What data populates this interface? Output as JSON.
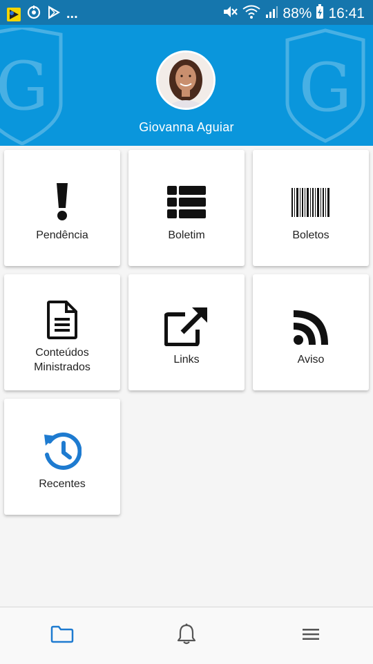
{
  "status_bar": {
    "overflow": "...",
    "battery": "88%",
    "time": "16:41"
  },
  "profile": {
    "name": "Giovanna Aguiar"
  },
  "watermark_letter": "G",
  "tiles": [
    {
      "label": "Pendência",
      "icon": "exclamation-icon"
    },
    {
      "label": "Boletim",
      "icon": "table-icon"
    },
    {
      "label": "Boletos",
      "icon": "barcode-icon"
    },
    {
      "label_line1": "Conteúdos",
      "label_line2": "Ministrados",
      "icon": "document-icon"
    },
    {
      "label": "Links",
      "icon": "external-link-icon"
    },
    {
      "label": "Aviso",
      "icon": "rss-icon"
    },
    {
      "label": "Recentes",
      "icon": "history-icon"
    }
  ],
  "bottom_nav": {
    "items": [
      "folder-icon",
      "bell-icon",
      "menu-icon"
    ],
    "active": "folder-icon"
  },
  "colors": {
    "status_bar": "#1576ad",
    "header": "#0a96dc",
    "accent": "#1e7bd0",
    "icon_dark": "#111111"
  }
}
